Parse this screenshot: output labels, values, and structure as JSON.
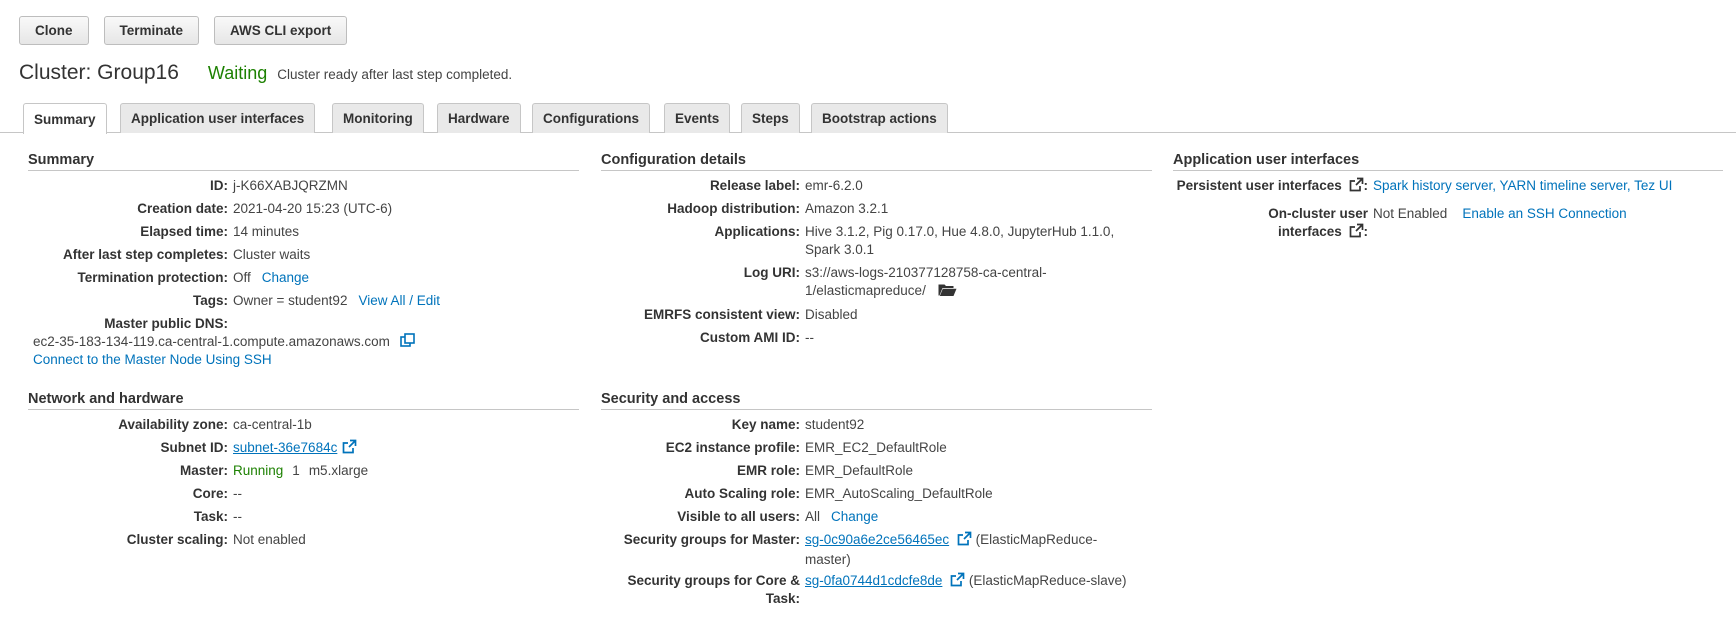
{
  "toolbar": {
    "clone": "Clone",
    "terminate": "Terminate",
    "cli_export": "AWS CLI export"
  },
  "header": {
    "title": "Cluster: Group16",
    "status": "Waiting",
    "status_message": "Cluster ready after last step completed."
  },
  "tabs": [
    "Summary",
    "Application user interfaces",
    "Monitoring",
    "Hardware",
    "Configurations",
    "Events",
    "Steps",
    "Bootstrap actions"
  ],
  "summary": {
    "title": "Summary",
    "id_label": "ID:",
    "id": "j-K66XABJQRZMN",
    "creation_label": "Creation date:",
    "creation": "2021-04-20 15:23 (UTC-6)",
    "elapsed_label": "Elapsed time:",
    "elapsed": "14 minutes",
    "after_label": "After last step completes:",
    "after": "Cluster waits",
    "termination_label": "Termination protection:",
    "termination": "Off",
    "termination_change": "Change",
    "tags_label": "Tags:",
    "tags": "Owner = student92",
    "tags_link": "View All / Edit",
    "dns_label": "Master public DNS:",
    "dns": "ec2-35-183-134-119.ca-central-1.compute.amazonaws.com",
    "ssh_link": "Connect to the Master Node Using SSH"
  },
  "network": {
    "title": "Network and hardware",
    "az_label": "Availability zone:",
    "az": "ca-central-1b",
    "subnet_label": "Subnet ID:",
    "subnet": "subnet-36e7684c",
    "master_label": "Master:",
    "master_status": "Running",
    "master_count": "1",
    "master_type": "m5.xlarge",
    "core_label": "Core:",
    "core": "--",
    "task_label": "Task:",
    "task": "--",
    "scaling_label": "Cluster scaling:",
    "scaling": "Not enabled"
  },
  "config": {
    "title": "Configuration details",
    "release_label": "Release label:",
    "release": "emr-6.2.0",
    "hadoop_label": "Hadoop distribution:",
    "hadoop": "Amazon 3.2.1",
    "apps_label": "Applications:",
    "apps_line1": "Hive 3.1.2, Pig 0.17.0, Hue 4.8.0, JupyterHub 1.1.0,",
    "apps_line2": "Spark 3.0.1",
    "log_label": "Log URI:",
    "log_line1": "s3://aws-logs-210377128758-ca-central-",
    "log_line2": "1/elasticmapreduce/",
    "emrfs_label": "EMRFS consistent view:",
    "emrfs": "Disabled",
    "ami_label": "Custom AMI ID:",
    "ami": "--"
  },
  "security": {
    "title": "Security and access",
    "key_label": "Key name:",
    "key": "student92",
    "profile_label": "EC2 instance profile:",
    "profile": "EMR_EC2_DefaultRole",
    "role_label": "EMR role:",
    "role": "EMR_DefaultRole",
    "autoscale_label": "Auto Scaling role:",
    "autoscale": "EMR_AutoScaling_DefaultRole",
    "visible_label": "Visible to all users:",
    "visible": "All",
    "visible_change": "Change",
    "sg_master_label": "Security groups for Master:",
    "sg_master": "sg-0c90a6e2ce56465ec",
    "sg_master_desc1": "(ElasticMapReduce-",
    "sg_master_desc2": "master)",
    "sg_core_label1": "Security groups for Core &",
    "sg_core_label2": "Task:",
    "sg_core": "sg-0fa0744d1cdcfe8de",
    "sg_core_desc": "(ElasticMapReduce-slave)"
  },
  "appui": {
    "title": "Application user interfaces",
    "persistent_label": "Persistent user interfaces",
    "persistent_links": "Spark history server, YARN timeline server, Tez UI",
    "oncluster_label1": "On-cluster user",
    "oncluster_label2": "interfaces",
    "oncluster_value": "Not Enabled",
    "ssh_enable": "Enable an SSH Connection"
  },
  "colors": {
    "link": "#0073bb",
    "status_green": "#1d8102",
    "text": "#444444"
  },
  "icons": [
    "external-link-icon",
    "copy-icon",
    "folder-open-icon"
  ]
}
